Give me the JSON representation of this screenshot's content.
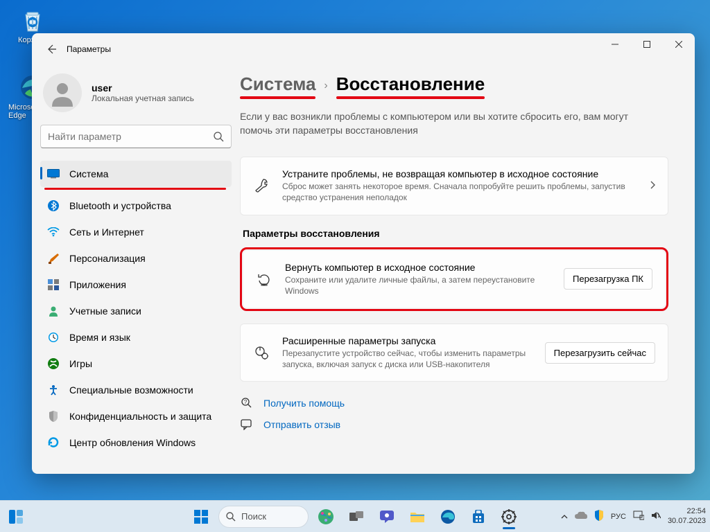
{
  "desktop": {
    "recycle_bin": "Корзина",
    "edge": "Microsoft Edge"
  },
  "window": {
    "title": "Параметры",
    "user_name": "user",
    "user_sub": "Локальная учетная запись",
    "search_placeholder": "Найти параметр"
  },
  "nav": {
    "system": "Система",
    "bluetooth": "Bluetooth и устройства",
    "network": "Сеть и Интернет",
    "personalization": "Персонализация",
    "apps": "Приложения",
    "accounts": "Учетные записи",
    "time": "Время и язык",
    "games": "Игры",
    "accessibility": "Специальные возможности",
    "privacy": "Конфиденциальность и защита",
    "update": "Центр обновления Windows"
  },
  "breadcrumb": {
    "root": "Система",
    "page": "Восстановление"
  },
  "intro": "Если у вас возникли проблемы с компьютером или вы хотите сбросить его, вам могут помочь эти параметры восстановления",
  "troubleshoot": {
    "title": "Устраните проблемы, не возвращая компьютер в исходное состояние",
    "sub": "Сброс может занять некоторое время. Сначала попробуйте решить проблемы, запустив средство устранения неполадок"
  },
  "section_label": "Параметры восстановления",
  "reset": {
    "title": "Вернуть компьютер в исходное состояние",
    "sub": "Сохраните или удалите личные файлы, а затем переустановите Windows",
    "button": "Перезагрузка ПК"
  },
  "advanced": {
    "title": "Расширенные параметры запуска",
    "sub": "Перезапустите устройство сейчас, чтобы изменить параметры запуска, включая запуск с диска или USB-накопителя",
    "button": "Перезагрузить сейчас"
  },
  "links": {
    "help": "Получить помощь",
    "feedback": "Отправить отзыв"
  },
  "taskbar": {
    "search": "Поиск",
    "lang": "РУС",
    "time": "22:54",
    "date": "30.07.2023"
  }
}
